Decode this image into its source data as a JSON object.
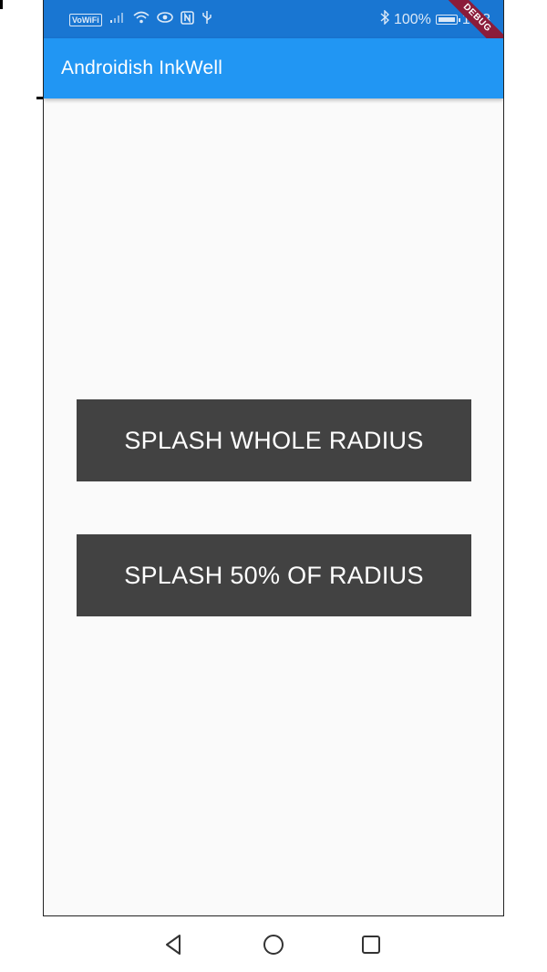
{
  "status_bar": {
    "vowifi_label": "VoWiFi",
    "battery_text": "100%",
    "time": "14:3",
    "debug_label": "DEBUG"
  },
  "app_bar": {
    "title": "Androidish InkWell"
  },
  "buttons": {
    "splash_whole": "SPLASH WHOLE RADIUS",
    "splash_half": "SPLASH 50% OF RADIUS"
  },
  "colors": {
    "status_bar": "#1976d2",
    "app_bar": "#2196f3",
    "button_bg": "#424242",
    "body_bg": "#fafafa",
    "debug_ribbon": "#8b1c3a"
  },
  "icons": {
    "status_left": [
      "vowifi-icon",
      "signal-icon",
      "wifi-icon",
      "eye-icon",
      "nfc-icon",
      "usb-icon"
    ],
    "status_right": [
      "bluetooth-icon",
      "battery-icon"
    ],
    "nav": [
      "back-icon",
      "home-icon",
      "recent-apps-icon"
    ]
  }
}
